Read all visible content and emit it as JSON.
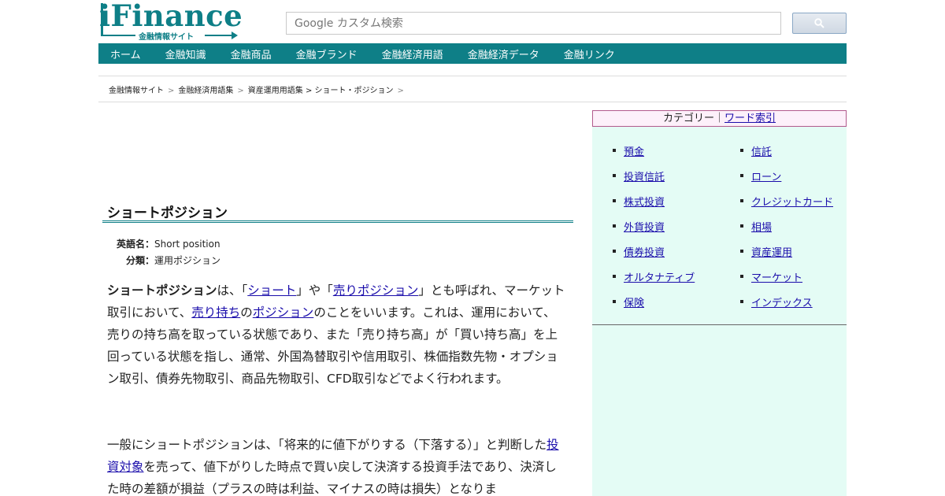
{
  "logo": {
    "text": "iFinance",
    "subtitle": "金融情報サイト"
  },
  "search": {
    "placeholder": "Google カスタム検索",
    "button_icon": "search-icon"
  },
  "nav": {
    "items": [
      "ホーム",
      "金融知識",
      "金融商品",
      "金融ブランド",
      "金融経済用語",
      "金融経済データ",
      "金融リンク"
    ]
  },
  "breadcrumb": {
    "items": [
      "金融情報サイト",
      "金融経済用語集",
      "資産運用用語集"
    ],
    "current": "ショート・ポジション",
    "separator": ">"
  },
  "article": {
    "title": "ショートポジション",
    "english_label": "英語名：",
    "english_value": "Short position",
    "category_label": "分類：",
    "category_value": "運用ポジション",
    "p1": {
      "term": "ショートポジション",
      "t1": "は、「",
      "l1": "ショート",
      "t2": "」や「",
      "l2": "売りポジション",
      "t3": "」とも呼ばれ、マーケット取引において、",
      "l3": "売り持ち",
      "t4": "の",
      "l4": "ポジション",
      "t5": "のことをいいます。これは、運用において、売りの持ち高を取っている状態であり、また「売り持ち高」が「買い持ち高」を上回っている状態を指し、通常、外国為替取引や信用取引、株価指数先物・オプション取引、債券先物取引、商品先物取引、CFD取引などでよく行われます。"
    },
    "p2": {
      "t1": "一般にショートポジションは、「将来的に値下がりする（下落する）」と判断した",
      "l1": "投資対象",
      "t2": "を売って、値下がりした時点で買い戻して決済する投資手法であり、決済した時の差額が損益（プラスの時は利益、マイナスの時は損失）となりま"
    }
  },
  "sidebar": {
    "category_label": "カテゴリー｜",
    "word_index_label": "ワード索引",
    "col1": [
      "預金",
      "投資信託",
      "株式投資",
      "外貨投資",
      "債券投資",
      "オルタナティブ",
      "保険"
    ],
    "col2": [
      "信託",
      "ローン",
      "クレジットカード",
      "相場",
      "資産運用",
      "マーケット",
      "インデックス"
    ]
  }
}
